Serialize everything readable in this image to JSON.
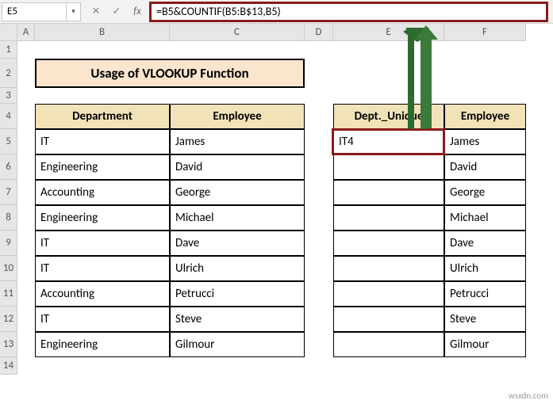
{
  "namebox": "E5",
  "formula": "=B5&COUNTIF(B5:B$13,B5)",
  "banner_title": "Usage of VLOOKUP Function",
  "columns": [
    "A",
    "B",
    "C",
    "D",
    "E",
    "F"
  ],
  "rows": [
    "1",
    "2",
    "3",
    "4",
    "5",
    "6",
    "7",
    "8",
    "9",
    "10",
    "11",
    "12",
    "13",
    "14"
  ],
  "table1": {
    "headers": [
      "Department",
      "Employee"
    ],
    "rows": [
      [
        "IT",
        "James"
      ],
      [
        "Engineering",
        "David"
      ],
      [
        "Accounting",
        "George"
      ],
      [
        "Engineering",
        "Michael"
      ],
      [
        "IT",
        "Dave"
      ],
      [
        "IT",
        "Ulrich"
      ],
      [
        "Accounting",
        "Petrucci"
      ],
      [
        "IT",
        "Steve"
      ],
      [
        "Engineering",
        "Gilmour"
      ]
    ]
  },
  "table2": {
    "headers": [
      "Dept._Unique",
      "Employee"
    ],
    "rows": [
      [
        "IT4",
        "James"
      ],
      [
        "",
        "David"
      ],
      [
        "",
        "George"
      ],
      [
        "",
        "Michael"
      ],
      [
        "",
        "Dave"
      ],
      [
        "",
        "Ulrich"
      ],
      [
        "",
        "Petrucci"
      ],
      [
        "",
        "Steve"
      ],
      [
        "",
        "Gilmour"
      ]
    ]
  },
  "watermark": "wsxdn.com",
  "colors": {
    "highlight": "#8b1a1a",
    "banner_bg": "#fce5cd",
    "header_bg": "#f2e2b8"
  }
}
